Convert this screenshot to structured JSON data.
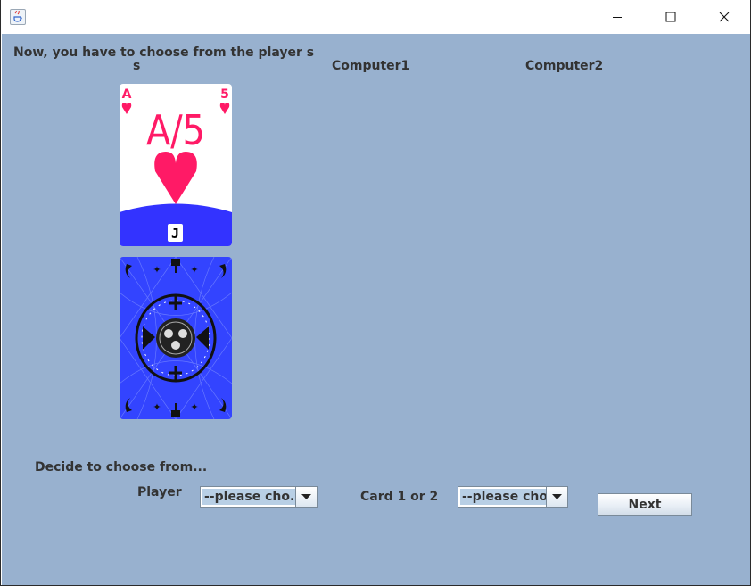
{
  "window": {
    "title": "",
    "controls": {
      "minimize": "minimize-icon",
      "maximize": "maximize-icon",
      "close": "close-icon"
    }
  },
  "header": {
    "instruction_line1": "Now, you have to choose from the player s",
    "instruction_line2": "s",
    "computer1": "Computer1",
    "computer2": "Computer2"
  },
  "cards": [
    {
      "face": "up",
      "rank_left": "A",
      "rank_right": "5",
      "center": "A/5",
      "suit": "heart",
      "badge": "J",
      "colors": {
        "red": "#ff1a66",
        "band": "#3333ff"
      }
    },
    {
      "face": "down",
      "colors": {
        "bg": "#3344ff"
      }
    }
  ],
  "decision": {
    "title": "Decide to choose from...",
    "player_label": "Player",
    "player_select": "--please cho...",
    "card_label": "Card 1 or 2",
    "card_select": "--please cho..."
  },
  "actions": {
    "next": "Next"
  },
  "colors": {
    "background": "#98b1cf",
    "selection": "#b8cfe5"
  }
}
